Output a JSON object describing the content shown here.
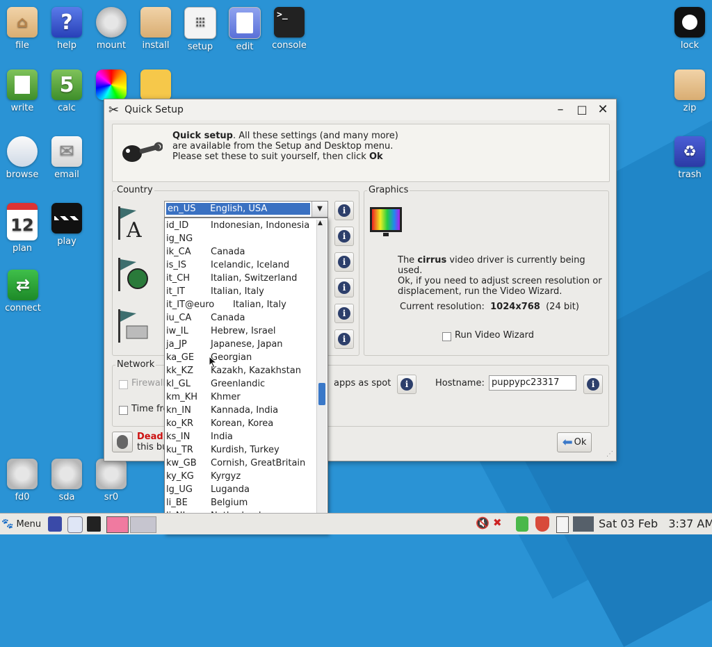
{
  "desktop": {
    "icons_left": [
      {
        "label": "file",
        "icon": "folder-icon"
      },
      {
        "label": "help",
        "icon": "help-icon"
      },
      {
        "label": "mount",
        "icon": "drive-icon"
      },
      {
        "label": "install",
        "icon": "box-icon"
      },
      {
        "label": "setup",
        "icon": "mixer-icon"
      },
      {
        "label": "edit",
        "icon": "text-editor-icon"
      },
      {
        "label": "console",
        "icon": "terminal-icon"
      },
      {
        "label": "write",
        "icon": "word-processor-icon"
      },
      {
        "label": "calc",
        "icon": "spreadsheet-icon"
      },
      {
        "label": "browse",
        "icon": "cloud-icon"
      },
      {
        "label": "email",
        "icon": "envelope-icon"
      },
      {
        "label": "plan",
        "icon": "calendar-icon"
      },
      {
        "label": "play",
        "icon": "clapperboard-icon"
      },
      {
        "label": "connect",
        "icon": "connect-arrows-icon"
      },
      {
        "label": "fd0",
        "icon": "floppy-icon"
      },
      {
        "label": "sda",
        "icon": "hard-disk-icon"
      },
      {
        "label": "sr0",
        "icon": "cdrom-icon"
      }
    ],
    "icons_right": [
      {
        "label": "lock",
        "icon": "lock-icon"
      },
      {
        "label": "zip",
        "icon": "archive-icon"
      },
      {
        "label": "trash",
        "icon": "recycle-icon"
      }
    ],
    "calendar_day": "12",
    "help_glyph": "?",
    "console_glyph": ">_",
    "calc_glyph": "5"
  },
  "window": {
    "title": "Quick Setup",
    "intro_bold": "Quick setup",
    "intro_line1_rest": ". All these settings (and many more)",
    "intro_line2": "are available from the Setup and Desktop menu.",
    "intro_line3_pre": "Please set these to suit yourself, then click ",
    "intro_line3_bold": "Ok",
    "country_label": "Country",
    "graphics_label": "Graphics",
    "network_label": "Network",
    "locale_selected": "en_US     English, USA",
    "driver_pre": "The ",
    "driver_bold": "cirrus",
    "driver_post": " video driver is currently being used.",
    "driver_line2": "Ok, if you need to adjust screen resolution or",
    "driver_line3": "displacement, run the Video Wizard.",
    "resolution_label": "Current resolution:",
    "resolution_value": "1024x768",
    "resolution_depth": "(24 bit)",
    "video_wizard_label": "Run Video Wizard",
    "firewall_label": "Firewall",
    "apps_spot_label": "apps as spot",
    "time_label": "Time fro",
    "hostname_label": "Hostname:",
    "hostname_value": "puppypc23317",
    "dead_label": "Dead",
    "this_bu_label": "this bu",
    "ok_label": "Ok",
    "info_glyph": "i"
  },
  "locale_options": [
    {
      "code": "id_ID",
      "name": "Indonesian, Indonesia"
    },
    {
      "code": "ig_NG",
      "name": ""
    },
    {
      "code": "ik_CA",
      "name": "Canada"
    },
    {
      "code": "is_IS",
      "name": "Icelandic, Iceland"
    },
    {
      "code": "it_CH",
      "name": "Italian, Switzerland"
    },
    {
      "code": "it_IT",
      "name": "Italian, Italy"
    },
    {
      "code": "it_IT@euro",
      "name": "Italian, Italy"
    },
    {
      "code": "iu_CA",
      "name": "Canada"
    },
    {
      "code": "iw_IL",
      "name": "Hebrew, Israel"
    },
    {
      "code": "ja_JP",
      "name": "Japanese, Japan"
    },
    {
      "code": "ka_GE",
      "name": "Georgian"
    },
    {
      "code": "kk_KZ",
      "name": "Kazakh, Kazakhstan"
    },
    {
      "code": "kl_GL",
      "name": "Greenlandic"
    },
    {
      "code": "km_KH",
      "name": "Khmer"
    },
    {
      "code": "kn_IN",
      "name": "Kannada, India"
    },
    {
      "code": "ko_KR",
      "name": "Korean, Korea"
    },
    {
      "code": "ks_IN",
      "name": "India"
    },
    {
      "code": "ku_TR",
      "name": "Kurdish, Turkey"
    },
    {
      "code": "kw_GB",
      "name": "Cornish, GreatBritain"
    },
    {
      "code": "ky_KG",
      "name": "Kyrgyz"
    },
    {
      "code": "lg_UG",
      "name": "Luganda"
    },
    {
      "code": "li_BE",
      "name": "Belgium"
    },
    {
      "code": "li_NL",
      "name": "Netherlands"
    }
  ],
  "taskbar": {
    "menu_label": "Menu",
    "datetime": "Sat 03 Feb   3:37 AM"
  },
  "colors": {
    "desktop_bg": "#2a93d5",
    "selection": "#3a71c2",
    "warning_red": "#cc1111"
  }
}
